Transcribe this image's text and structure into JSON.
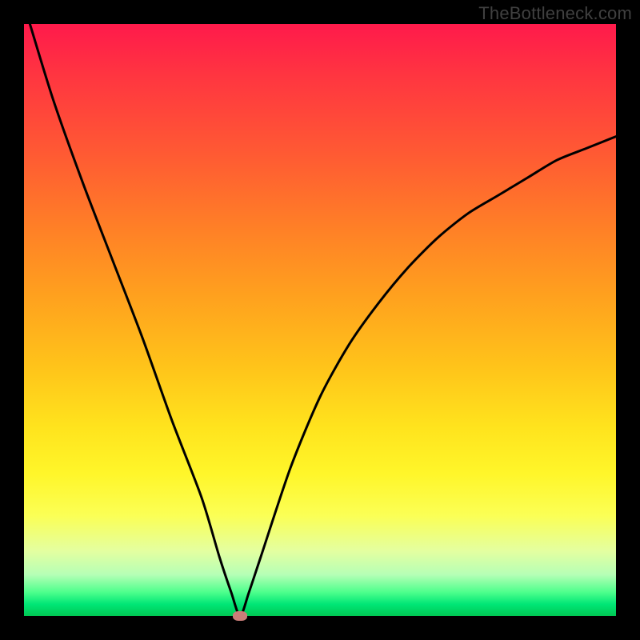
{
  "watermark": "TheBottleneck.com",
  "chart_data": {
    "type": "line",
    "title": "",
    "xlabel": "",
    "ylabel": "",
    "xlim": [
      0,
      100
    ],
    "ylim": [
      0,
      100
    ],
    "grid": false,
    "legend": false,
    "series": [
      {
        "name": "curve",
        "x": [
          1,
          5,
          10,
          15,
          20,
          25,
          30,
          33,
          35,
          36.5,
          38,
          40,
          45,
          50,
          55,
          60,
          65,
          70,
          75,
          80,
          85,
          90,
          95,
          100
        ],
        "y": [
          100,
          87,
          73,
          60,
          47,
          33,
          20,
          10,
          4,
          0,
          4,
          10,
          25,
          37,
          46,
          53,
          59,
          64,
          68,
          71,
          74,
          77,
          79,
          81
        ]
      }
    ],
    "marker": {
      "x": 36.5,
      "y": 0,
      "color": "#cb7d79"
    },
    "background_gradient": {
      "top": "#ff1a4b",
      "bottom": "#00c853"
    }
  }
}
